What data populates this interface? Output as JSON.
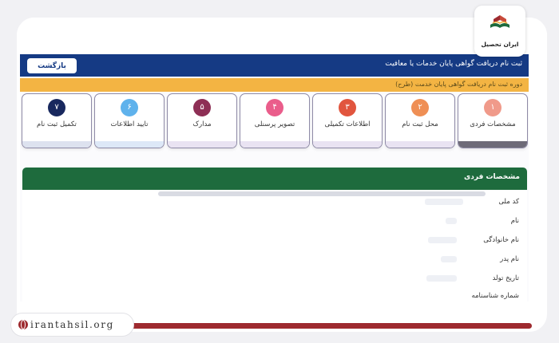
{
  "header": {
    "title": "ثبت نام دریافت گواهی پایان خدمات یا معافیت",
    "back_label": "بازگشت"
  },
  "subheader": {
    "note": "دوره ثبت نام دریافت گواهی پایان خدمت (طرح)"
  },
  "steps": [
    {
      "number": "۱",
      "label": "مشخصات فردی",
      "color": "#f09a8a",
      "bottom": "#6e6b78"
    },
    {
      "number": "۲",
      "label": "محل ثبت نام",
      "color": "#ef8f55",
      "bottom": "#e9e3f2"
    },
    {
      "number": "۳",
      "label": "اطلاعات تکمیلی",
      "color": "#e1553e",
      "bottom": "#e9e3f2"
    },
    {
      "number": "۴",
      "label": "تصویر پرسنلی",
      "color": "#ea5d8b",
      "bottom": "#e9e3f2"
    },
    {
      "number": "۵",
      "label": "مدارک",
      "color": "#8e2f55",
      "bottom": "#e9e3f2"
    },
    {
      "number": "۶",
      "label": "تایید اطلاعات",
      "color": "#5fb2ec",
      "bottom": "#dde8f7"
    },
    {
      "number": "۷",
      "label": "تکمیل ثبت نام",
      "color": "#18285e",
      "bottom": "#dde2ef"
    }
  ],
  "panel": {
    "title": "مشخصات فردی",
    "fields": [
      "کد ملی",
      "نام",
      "نام خانوادگی",
      "نام پدر",
      "تاریخ تولد",
      "شماره شناسنامه"
    ]
  },
  "watermark": {
    "url": "irantahsil.org",
    "logo_name": "ایران تحصیل"
  },
  "colors": {
    "header_blue": "#153a84",
    "notice_yellow": "#f3b443",
    "panel_green": "#1e6b3d",
    "brand_red": "#9e2a2f"
  }
}
